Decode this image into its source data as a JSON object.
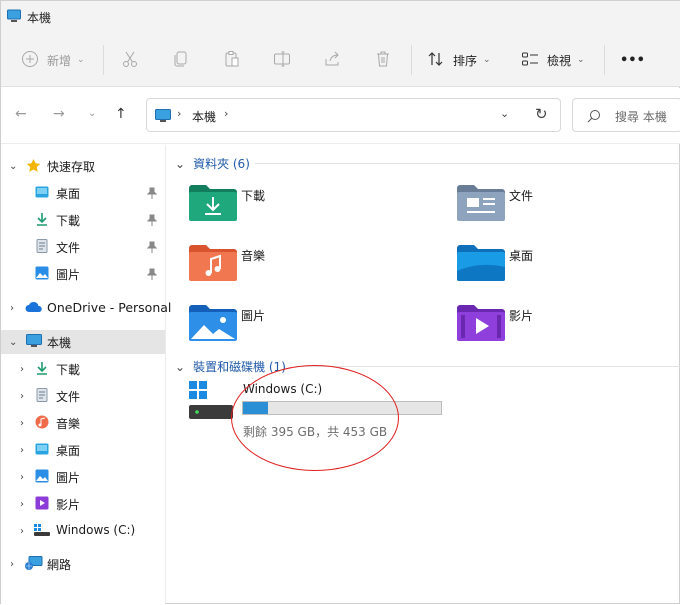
{
  "window": {
    "title": "本機"
  },
  "toolbar": {
    "new_label": "新增",
    "sort_label": "排序",
    "view_label": "檢視",
    "more_label": "•••"
  },
  "address": {
    "location": "本機",
    "search_placeholder": "搜尋 本機"
  },
  "sidebar": {
    "quick_access": "快速存取",
    "quick_items": [
      {
        "label": "桌面",
        "icon": "desktop-icon"
      },
      {
        "label": "下載",
        "icon": "download-icon"
      },
      {
        "label": "文件",
        "icon": "document-icon"
      },
      {
        "label": "圖片",
        "icon": "picture-icon"
      }
    ],
    "onedrive": "OneDrive - Personal",
    "this_pc": "本機",
    "pc_items": [
      {
        "label": "下載",
        "icon": "download-icon"
      },
      {
        "label": "文件",
        "icon": "document-icon"
      },
      {
        "label": "音樂",
        "icon": "music-icon"
      },
      {
        "label": "桌面",
        "icon": "desktop-icon"
      },
      {
        "label": "圖片",
        "icon": "picture-icon"
      },
      {
        "label": "影片",
        "icon": "video-icon"
      },
      {
        "label": "Windows (C:)",
        "icon": "drive-icon"
      }
    ],
    "network": "網路"
  },
  "content": {
    "folders_header": "資料夾 (6)",
    "folders": [
      {
        "label": "下載",
        "icon": "download-folder-icon"
      },
      {
        "label": "文件",
        "icon": "document-folder-icon"
      },
      {
        "label": "音樂",
        "icon": "music-folder-icon"
      },
      {
        "label": "桌面",
        "icon": "desktop-folder-icon"
      },
      {
        "label": "圖片",
        "icon": "picture-folder-icon"
      },
      {
        "label": "影片",
        "icon": "video-folder-icon"
      }
    ],
    "drives_header": "裝置和磁碟機 (1)",
    "drive": {
      "name": "Windows (C:)",
      "info": "剩餘 395 GB，共 453 GB",
      "used_fraction": 0.128
    }
  },
  "colors": {
    "accent": "#2b8fd6",
    "highlight_circle": "#e02020",
    "group_header": "#1f5aa8"
  }
}
